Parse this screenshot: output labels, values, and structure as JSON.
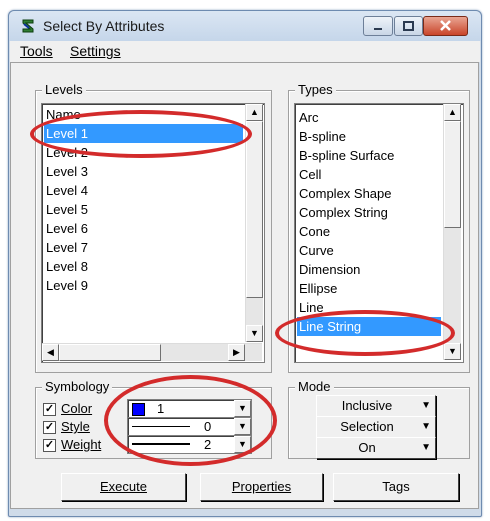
{
  "window": {
    "title": "Select By Attributes"
  },
  "menu": {
    "tools": "Tools",
    "settings": "Settings"
  },
  "levels": {
    "legend": "Levels",
    "header": "Name",
    "items": [
      "Level 1",
      "Level 2",
      "Level 3",
      "Level 4",
      "Level 5",
      "Level 6",
      "Level 7",
      "Level 8",
      "Level 9"
    ],
    "selected": "Level 1"
  },
  "types": {
    "legend": "Types",
    "items": [
      "Arc",
      "B-spline",
      "B-spline Surface",
      "Cell",
      "Complex Shape",
      "Complex String",
      "Cone",
      "Curve",
      "Dimension",
      "Ellipse",
      "Line",
      "Line String"
    ],
    "selected": "Line String"
  },
  "symbology": {
    "legend": "Symbology",
    "color_label": "Color",
    "style_label": "Style",
    "weight_label": "Weight",
    "color_value": "1",
    "style_value": "0",
    "weight_value": "2",
    "color_swatch": "#0000ff",
    "color_checked": true,
    "style_checked": true,
    "weight_checked": true
  },
  "mode": {
    "legend": "Mode",
    "option1": "Inclusive",
    "option2": "Selection",
    "option3": "On"
  },
  "buttons": {
    "execute": "Execute",
    "properties": "Properties",
    "tags": "Tags"
  },
  "annotation_color": "#d32b2b"
}
